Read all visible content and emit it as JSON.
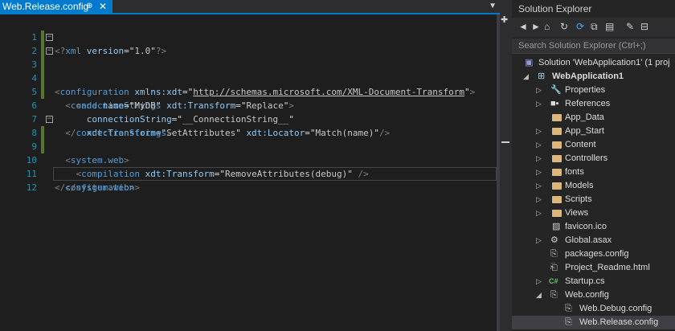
{
  "editor": {
    "tab": {
      "title": "Web.Release.config",
      "pin_icon": "pin-icon",
      "close_icon": "close-icon"
    },
    "lines": [
      {
        "num": "1",
        "text": "<?xml version=\"1.0\"?>"
      },
      {
        "num": "2",
        "text": "<configuration xmlns:xdt=\"http://schemas.microsoft.com/XML-Document-Transform\">"
      },
      {
        "num": "3",
        "text": "  <connectionStrings xdt:Transform=\"Replace\">"
      },
      {
        "num": "4",
        "text": "    <add name=\"MyDB\""
      },
      {
        "num": "5",
        "text": "      connectionString=\"__ConnectionString__\""
      },
      {
        "num": "6",
        "text": "      xdt:Transform=\"SetAttributes\" xdt:Locator=\"Match(name)\"/>"
      },
      {
        "num": "7",
        "text": "  </connectionStrings>"
      },
      {
        "num": "8",
        "text": "  <system.web>"
      },
      {
        "num": "9",
        "text": "    <compilation xdt:Transform=\"RemoveAttributes(debug)\" />"
      },
      {
        "num": "10",
        "text": "  </system.web>"
      },
      {
        "num": "11",
        "text": "</configuration>"
      },
      {
        "num": "12",
        "text": ""
      }
    ]
  },
  "solution_explorer": {
    "title": "Solution Explorer",
    "search_placeholder": "Search Solution Explorer (Ctrl+;)",
    "solution_label": "Solution 'WebApplication1' (1 proj",
    "project_label": "WebApplication1",
    "items": [
      {
        "label": "Properties",
        "icon": "wrench-icon"
      },
      {
        "label": "References",
        "icon": "references-icon"
      },
      {
        "label": "App_Data",
        "icon": "folder-icon"
      },
      {
        "label": "App_Start",
        "icon": "folder-icon"
      },
      {
        "label": "Content",
        "icon": "folder-icon"
      },
      {
        "label": "Controllers",
        "icon": "folder-icon"
      },
      {
        "label": "fonts",
        "icon": "folder-icon"
      },
      {
        "label": "Models",
        "icon": "folder-icon"
      },
      {
        "label": "Scripts",
        "icon": "folder-icon"
      },
      {
        "label": "Views",
        "icon": "folder-icon"
      },
      {
        "label": "favicon.ico",
        "icon": "image-file-icon"
      },
      {
        "label": "Global.asax",
        "icon": "asax-file-icon"
      },
      {
        "label": "packages.config",
        "icon": "config-file-icon"
      },
      {
        "label": "Project_Readme.html",
        "icon": "html-file-icon"
      },
      {
        "label": "Startup.cs",
        "icon": "csharp-file-icon"
      },
      {
        "label": "Web.config",
        "icon": "config-file-icon"
      },
      {
        "label": "Web.Debug.config",
        "icon": "config-file-icon"
      },
      {
        "label": "Web.Release.config",
        "icon": "config-file-icon"
      }
    ]
  }
}
